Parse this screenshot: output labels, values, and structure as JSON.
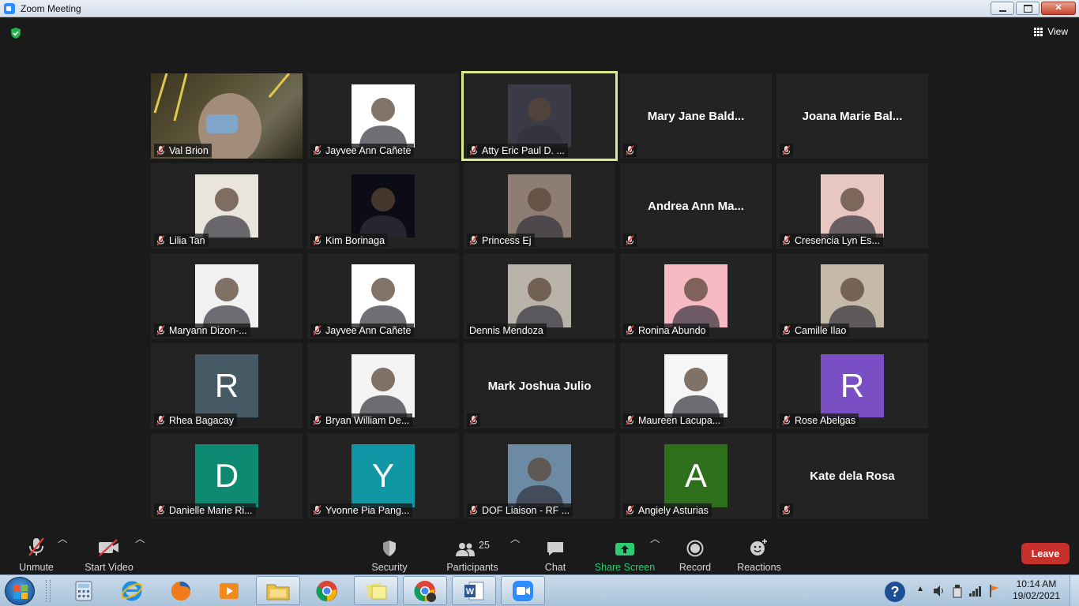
{
  "window": {
    "title": "Zoom Meeting"
  },
  "topbar": {
    "view_label": "View"
  },
  "tiles": [
    {
      "name": "Val Brion",
      "muted": true,
      "kind": "video",
      "bg": "#5a5236"
    },
    {
      "name": "Jayvee Ann Cañete",
      "muted": true,
      "kind": "photo",
      "bg": "#ffffff"
    },
    {
      "name": "Atty Eric Paul D. ...",
      "muted": true,
      "kind": "photo",
      "bg": "#3b3b47",
      "active": true
    },
    {
      "name": "Mary Jane Bald...",
      "muted": true,
      "kind": "name"
    },
    {
      "name": "Joana Marie Bal...",
      "muted": true,
      "kind": "name"
    },
    {
      "name": "Lilia Tan",
      "muted": true,
      "kind": "photo",
      "bg": "#e9e4dc"
    },
    {
      "name": "Kim Borinaga",
      "muted": true,
      "kind": "photo",
      "bg": "#0b0c16"
    },
    {
      "name": "Princess Ej",
      "muted": true,
      "kind": "photo",
      "bg": "#8d7d73"
    },
    {
      "name": "Andrea Ann Ma...",
      "muted": true,
      "kind": "name"
    },
    {
      "name": "Cresencia Lyn Es...",
      "muted": true,
      "kind": "photo",
      "bg": "#e8c7c3"
    },
    {
      "name": "Maryann Dizon-...",
      "muted": true,
      "kind": "photo",
      "bg": "#f1f1f1"
    },
    {
      "name": "Jayvee Ann Cañete",
      "muted": true,
      "kind": "photo",
      "bg": "#ffffff"
    },
    {
      "name": "Dennis Mendoza",
      "muted": false,
      "kind": "photo",
      "bg": "#b9b2a8"
    },
    {
      "name": "Ronina Abundo",
      "muted": true,
      "kind": "photo",
      "bg": "#f7b9c4"
    },
    {
      "name": "Camille Ilao",
      "muted": true,
      "kind": "photo",
      "bg": "#c7b9a8"
    },
    {
      "name": "Rhea Bagacay",
      "muted": true,
      "kind": "avatar",
      "letter": "R",
      "bg": "#465a66"
    },
    {
      "name": "Bryan William De...",
      "muted": true,
      "kind": "photo",
      "bg": "#f3f3f3"
    },
    {
      "name": "Mark Joshua Julio",
      "muted": true,
      "kind": "name",
      "hide_label": true
    },
    {
      "name": "Maureen Lacupa...",
      "muted": true,
      "kind": "photo",
      "bg": "#f6f6f6"
    },
    {
      "name": "Rose Abelgas",
      "muted": true,
      "kind": "avatar",
      "letter": "R",
      "bg": "#7b4fc4"
    },
    {
      "name": "Danielle Marie Ri...",
      "muted": true,
      "kind": "avatar",
      "letter": "D",
      "bg": "#0e8a73"
    },
    {
      "name": "Yvonne Pia Pang...",
      "muted": true,
      "kind": "avatar",
      "letter": "Y",
      "bg": "#1097a6"
    },
    {
      "name": "DOF Liaison - RF ...",
      "muted": true,
      "kind": "photo",
      "bg": "#6c8aa4"
    },
    {
      "name": "Angiely Asturias",
      "muted": true,
      "kind": "avatar",
      "letter": "A",
      "bg": "#2e6f1c"
    },
    {
      "name": "Kate dela Rosa",
      "muted": true,
      "kind": "name",
      "hide_label": true
    }
  ],
  "toolbar": {
    "unmute": "Unmute",
    "start_video": "Start Video",
    "security": "Security",
    "participants": "Participants",
    "participants_count": "25",
    "chat": "Chat",
    "share_screen": "Share Screen",
    "record": "Record",
    "reactions": "Reactions",
    "leave": "Leave"
  },
  "taskbar": {
    "time": "10:14 AM",
    "date": "19/02/2021"
  },
  "colors": {
    "accent_green": "#2ecc71",
    "leave_red": "#c8302c",
    "active_speaker": "#d9ec8e"
  }
}
